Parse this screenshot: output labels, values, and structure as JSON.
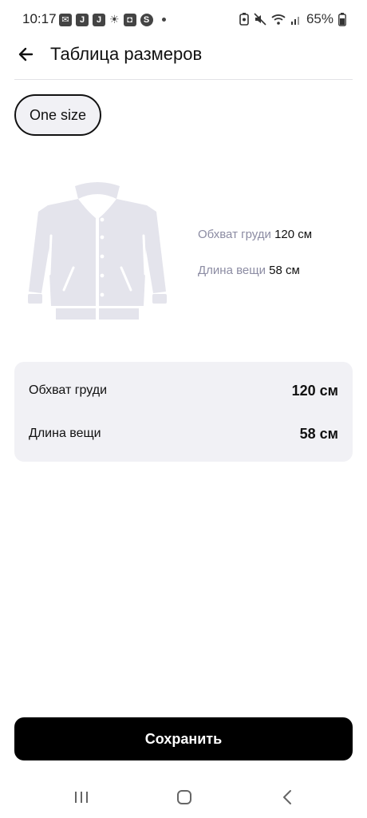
{
  "status_bar": {
    "time": "10:17",
    "battery": "65%",
    "left_icons": [
      "mail-icon",
      "app-j-icon",
      "app-j-icon",
      "brightness-icon",
      "square-app-icon",
      "shazam-icon"
    ],
    "right_icons": [
      "battery-saver-icon",
      "mute-icon",
      "wifi-icon",
      "signal-icon",
      "battery-icon"
    ]
  },
  "header": {
    "title": "Таблица размеров",
    "back_icon": "arrow-left-icon"
  },
  "size_chip": {
    "label": "One size"
  },
  "illustration": {
    "icon": "jacket-icon",
    "labels": [
      {
        "key": "Обхват груди",
        "value": "120 см"
      },
      {
        "key": "Длина вещи",
        "value": "58 см"
      }
    ]
  },
  "size_table": {
    "rows": [
      {
        "label": "Обхват груди",
        "value": "120 см"
      },
      {
        "label": "Длина вещи",
        "value": "58 см"
      }
    ]
  },
  "actions": {
    "save_label": "Сохранить"
  },
  "nav_bar": {
    "icons": [
      "recent-apps-icon",
      "home-icon",
      "back-icon"
    ]
  },
  "colors": {
    "accent": "#000000",
    "chip_bg": "#f1f1f5",
    "table_bg": "#f1f1f5",
    "muted_text": "#8c8ca3",
    "illustration": "#e4e4ec"
  }
}
